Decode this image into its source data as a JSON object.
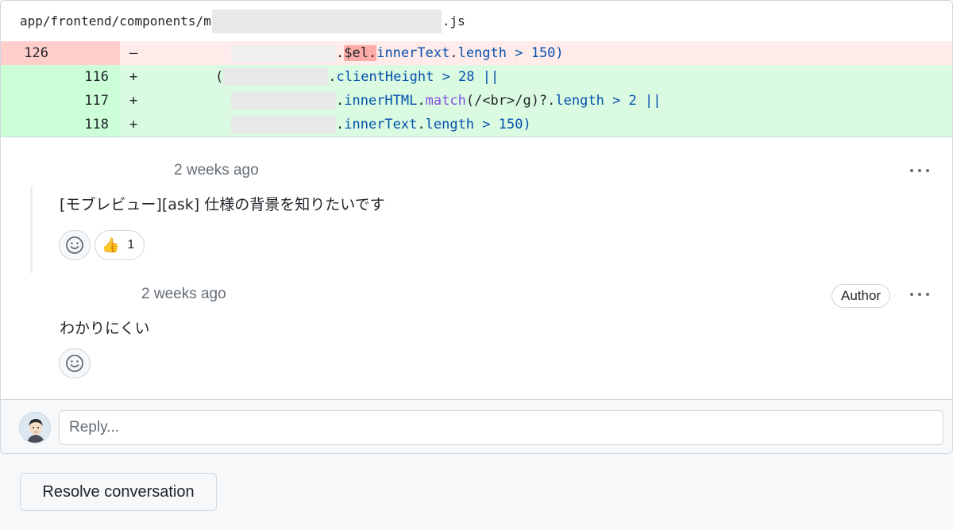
{
  "file": {
    "path_prefix": "app/frontend/components/m",
    "path_suffix": ".js"
  },
  "diff": {
    "rows": [
      {
        "type": "del",
        "old_ln": "126",
        "new_ln": "",
        "sign": "–",
        "pre": ".",
        "hl": "$el.",
        "prop1": "innerText",
        "mid": ".",
        "prop2": "length",
        "rest": " > 150)"
      },
      {
        "type": "add",
        "old_ln": "",
        "new_ln": "116",
        "sign": "+",
        "lead": "(",
        "pre": ".",
        "prop1": "clientHeight",
        "rest": " > 28 ||"
      },
      {
        "type": "add",
        "old_ln": "",
        "new_ln": "117",
        "sign": "+",
        "pre": ".",
        "prop1": "innerHTML",
        "mid": ".",
        "fn": "match",
        "mid2": "(/<br>/g)?.",
        "prop2": "length",
        "rest": " > 2 ||"
      },
      {
        "type": "add",
        "old_ln": "",
        "new_ln": "118",
        "sign": "+",
        "pre": ".",
        "prop1": "innerText",
        "mid": ".",
        "prop2": "length",
        "rest": " > 150)"
      }
    ]
  },
  "comments": [
    {
      "time": "2 weeks ago",
      "body": "[モブレビュー][ask] 仕様の背景を知りたいです",
      "reaction_emoji": "👍",
      "reaction_count": "1"
    },
    {
      "time": "2 weeks ago",
      "badge": "Author",
      "body": "わかりにくい"
    }
  ],
  "icons": {
    "emoji_add": "smiley-icon",
    "more": "kebab-horizontal-icon"
  },
  "reply": {
    "placeholder": "Reply..."
  },
  "actions": {
    "resolve_label": "Resolve conversation"
  }
}
